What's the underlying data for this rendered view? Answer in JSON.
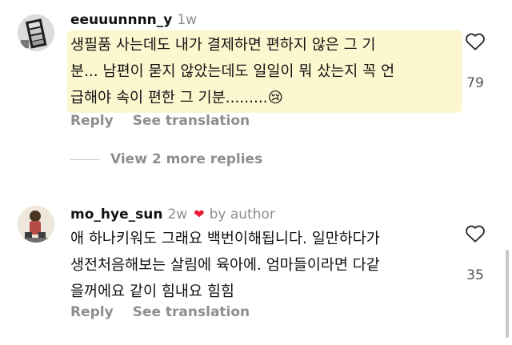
{
  "comments": [
    {
      "username": "eeuuunnnn_y",
      "age": "1w",
      "text": "생필품 사는데도 내가 결제하면 편하지 않은 그 기\n분... 남편이 묻지 않았는데도 일일이 뭐 샀는지 꼭 언\n급해야 속이 편한 그 기분.........😢",
      "likes": "79",
      "reply_label": "Reply",
      "translate_label": "See translation"
    },
    {
      "username": "mo_hye_sun",
      "age": "2w",
      "byauthor": "by author",
      "text": "애 하나키워도 그래요 백번이해됩니다. 일만하다가\n생전처음해보는 살림에 육아에.  엄마들이라면 다같\n을꺼에요 같이 힘내요 힘힘",
      "likes": "35",
      "reply_label": "Reply",
      "translate_label": "See translation"
    }
  ],
  "view_more_replies": "View 2 more replies",
  "colors": {
    "highlight": "#fdf7cf",
    "heart_red": "#ed1a3b",
    "muted": "#8e8e8e"
  }
}
